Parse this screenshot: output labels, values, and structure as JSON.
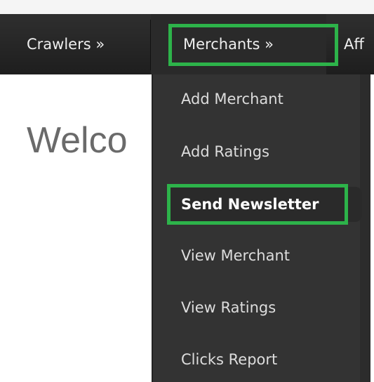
{
  "nav": {
    "crawlers": "Crawlers »",
    "merchants": "Merchants »",
    "affiliates_partial": "Aff"
  },
  "main": {
    "welcome_partial": "Welco"
  },
  "merchants_menu": {
    "items": [
      {
        "label": "Add Merchant"
      },
      {
        "label": "Add Ratings"
      },
      {
        "label": "Send Newsletter",
        "active": true
      },
      {
        "label": "View Merchant"
      },
      {
        "label": "View Ratings"
      },
      {
        "label": "Clicks Report"
      }
    ]
  },
  "colors": {
    "highlight": "#2db34a",
    "navbar": "#262626",
    "dropdown": "#333333"
  }
}
